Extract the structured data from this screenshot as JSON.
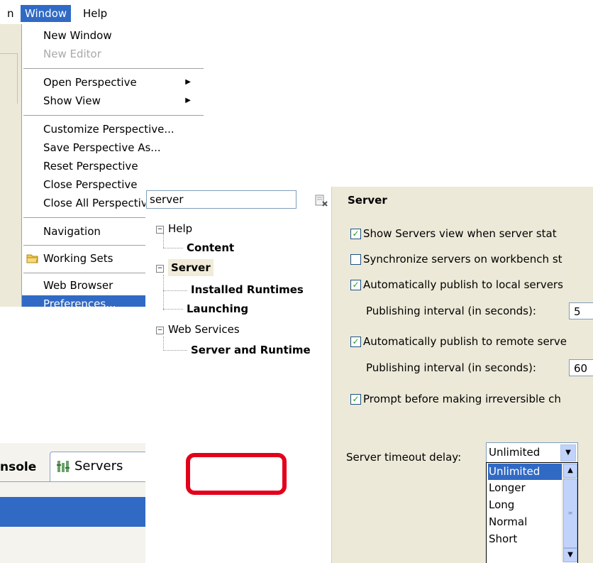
{
  "menubar": {
    "left_fragment": "n",
    "window": "Window",
    "help": "Help"
  },
  "window_menu": {
    "items": [
      {
        "label": "New Window"
      },
      {
        "label": "New Editor",
        "disabled": true
      },
      {
        "label": "Open Perspective",
        "submenu": true
      },
      {
        "label": "Show View",
        "submenu": true
      },
      {
        "label": "Customize Perspective..."
      },
      {
        "label": "Save Perspective As..."
      },
      {
        "label": "Reset Perspective"
      },
      {
        "label": "Close Perspective"
      },
      {
        "label": "Close All Perspective"
      },
      {
        "label": "Navigation"
      },
      {
        "label": "Working Sets",
        "icon": "folder-icon"
      },
      {
        "label": "Web Browser"
      },
      {
        "label": "Preferences...",
        "selected": true
      }
    ],
    "submenu_arrow": "▶"
  },
  "bottom_tabs": {
    "console": "nsole",
    "servers": "Servers"
  },
  "preferences": {
    "filter_value": "server",
    "tree": {
      "help": "Help",
      "content": "Content",
      "server": "Server",
      "installed_runtimes": "Installed Runtimes",
      "launching": "Launching",
      "web_services": "Web Services",
      "server_and_runtime": "Server and Runtime",
      "expander_collapse": "−"
    },
    "settings": {
      "title": "Server",
      "show_servers_view": {
        "label": "Show Servers view when server stat",
        "checked": true
      },
      "synchronize_servers": {
        "label": "Synchronize servers on workbench st",
        "checked": false
      },
      "auto_publish_local": {
        "label": "Automatically publish to local servers",
        "checked": true
      },
      "local_interval_label": "Publishing interval (in seconds):",
      "local_interval_value": "5",
      "auto_publish_remote": {
        "label": "Automatically publish to remote serve",
        "checked": true
      },
      "remote_interval_label": "Publishing interval (in seconds):",
      "remote_interval_value": "60",
      "prompt_irreversible": {
        "label": "Prompt before making irreversible ch",
        "checked": true
      },
      "checkmark": "✓",
      "timeout_label": "Server timeout delay:",
      "timeout_value": "Unlimited",
      "timeout_options": [
        "Unlimited",
        "Longer",
        "Long",
        "Normal",
        "Short"
      ],
      "timeout_selected": "Unlimited",
      "scroll_up": "▲",
      "scroll_down": "▼",
      "combo_arrow": "▼",
      "thumb_grip": "≡"
    }
  },
  "colors": {
    "selection_blue": "#316ac5",
    "highlight_red": "#e3001b",
    "dialog_bg": "#ece9d8"
  }
}
